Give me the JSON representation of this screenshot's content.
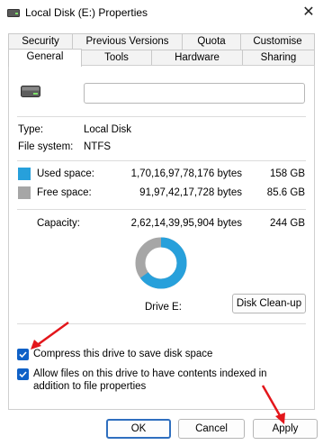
{
  "window": {
    "title": "Local Disk (E:) Properties",
    "close_glyph": "✕"
  },
  "tabs_row1": [
    "Security",
    "Previous Versions",
    "Quota",
    "Customise"
  ],
  "tabs_row2": [
    "General",
    "Tools",
    "Hardware",
    "Sharing"
  ],
  "general": {
    "name_value": "",
    "type_label": "Type:",
    "type_value": "Local Disk",
    "fs_label": "File system:",
    "fs_value": "NTFS",
    "used_label": "Used space:",
    "used_bytes": "1,70,16,97,78,176 bytes",
    "used_size": "158 GB",
    "free_label": "Free space:",
    "free_bytes": "91,97,42,17,728 bytes",
    "free_size": "85.6 GB",
    "cap_label": "Capacity:",
    "cap_bytes": "2,62,14,39,95,904 bytes",
    "cap_size": "244 GB",
    "drive_label": "Drive E:",
    "cleanup_label": "Disk Clean-up",
    "compress_label": "Compress this drive to save disk space",
    "index_label": "Allow files on this drive to have contents indexed in addition to file properties",
    "used_fraction": 0.65
  },
  "colors": {
    "used": "#27a0db",
    "free": "#a6a6a6",
    "accent": "#0f61c7",
    "annotation": "#e3161b"
  },
  "buttons": {
    "ok": "OK",
    "cancel": "Cancel",
    "apply": "Apply"
  }
}
